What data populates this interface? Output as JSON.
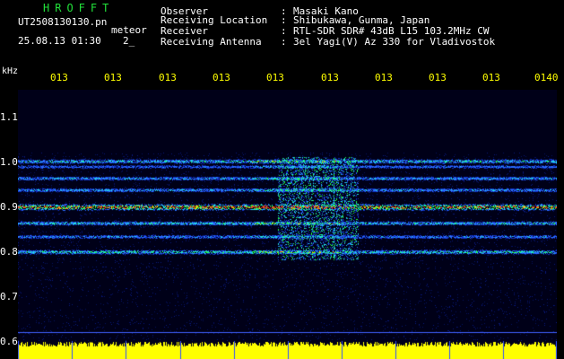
{
  "app": {
    "title": "HROFFT"
  },
  "file": {
    "name": "UT2508130130.pn",
    "label": "meteor"
  },
  "timestamp": {
    "date_time": "25.08.13 01:30",
    "extra": "2_"
  },
  "info": [
    {
      "label": "Observer",
      "value": "Masaki Kano"
    },
    {
      "label": "Receiving Location",
      "value": "Shibukawa, Gunma, Japan"
    },
    {
      "label": "Receiver",
      "value": "RTL-SDR SDR# 43dB L15 103.2MHz CW"
    },
    {
      "label": "Receiving Antenna",
      "value": "3el Yagi(V) Az 330 for Vladivostok"
    }
  ],
  "axis": {
    "y_unit": "kHz",
    "y_ticks": [
      "1.1",
      "1.0",
      "0.9",
      "0.8",
      "0.7",
      "0.6"
    ],
    "x_ticks": [
      "013",
      "013",
      "013",
      "013",
      "013",
      "013",
      "013",
      "013",
      "013",
      "0140"
    ]
  },
  "colors": {
    "background": "#000018",
    "signal_low": "#0044ff",
    "signal_high": "#ff2020",
    "amplitude_bar": "#ffff00",
    "title": "#22e03a"
  }
}
